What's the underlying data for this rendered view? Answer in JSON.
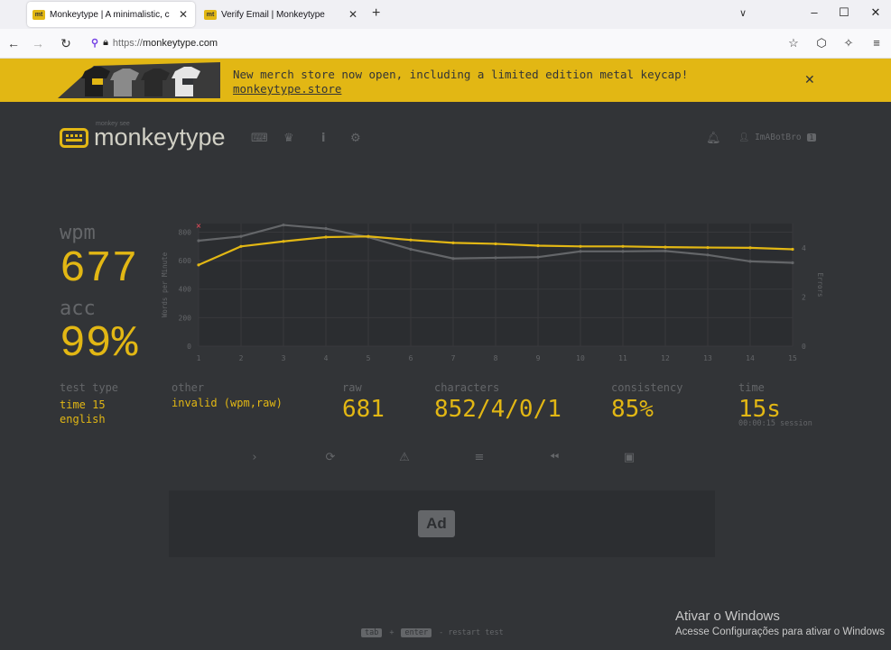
{
  "browser": {
    "tabs": [
      {
        "title": "Monkeytype | A minimalistic, c",
        "icon": "mt",
        "active": true
      },
      {
        "title": "Verify Email | Monkeytype",
        "icon": "mt",
        "active": false
      }
    ],
    "url_prefix": "https://",
    "url_host": "monkeytype.com"
  },
  "banner": {
    "text": "New merch store now open, including a limited edition metal keycap!",
    "link": "monkeytype.store"
  },
  "header": {
    "logo_sub": "monkey see",
    "logo_text": "monkeytype",
    "username": "ImABotBro",
    "badge": "1"
  },
  "stats": {
    "wpm_label": "wpm",
    "wpm": "677",
    "acc_label": "acc",
    "acc": "99%",
    "test_type_label": "test type",
    "test_type_1": "time 15",
    "test_type_2": "english",
    "other_label": "other",
    "other": "invalid (wpm,raw)",
    "raw_label": "raw",
    "raw": "681",
    "characters_label": "characters",
    "characters": "852/4/0/1",
    "consistency_label": "consistency",
    "consistency": "85%",
    "time_label": "time",
    "time": "15s",
    "session": "00:00:15 session"
  },
  "chart_data": {
    "type": "line",
    "x": [
      1,
      2,
      3,
      4,
      5,
      6,
      7,
      8,
      9,
      10,
      11,
      12,
      13,
      14,
      15
    ],
    "series": [
      {
        "name": "wpm",
        "color": "#e2b714",
        "values": [
          570,
          700,
          735,
          765,
          770,
          745,
          725,
          718,
          705,
          700,
          700,
          695,
          692,
          690,
          680
        ]
      },
      {
        "name": "raw",
        "color": "#646669",
        "values": [
          740,
          770,
          850,
          825,
          765,
          680,
          615,
          620,
          625,
          665,
          665,
          668,
          640,
          595,
          585
        ]
      }
    ],
    "errors": [
      {
        "x": 1,
        "value": 1
      }
    ],
    "ylabel": "Words per Minute",
    "y2label": "Errors",
    "yticks": [
      "0",
      "200",
      "400",
      "600",
      "800"
    ],
    "y2ticks": [
      "0",
      "2",
      "4"
    ],
    "ylim": [
      0,
      860
    ],
    "grid": true
  },
  "actions": [
    "next-test",
    "restart",
    "report",
    "words-history",
    "replay",
    "screenshot"
  ],
  "ad": {
    "label": "Ad"
  },
  "footer": {
    "key1": "tab",
    "plus": "+",
    "key2": "enter",
    "hint": "- restart test"
  },
  "watermark": {
    "title": "Ativar o Windows",
    "sub": "Acesse Configurações para ativar o Windows"
  }
}
